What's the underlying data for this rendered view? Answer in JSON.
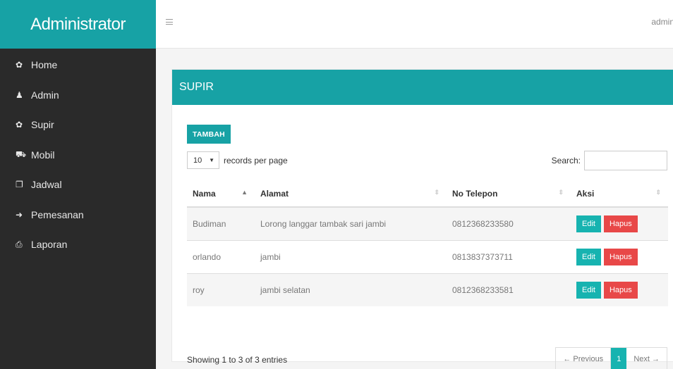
{
  "sidebar": {
    "brand": "Administrator",
    "items": [
      {
        "label": "Home",
        "icon": "dashboard-icon",
        "glyph": "✿"
      },
      {
        "label": "Admin",
        "icon": "user-icon",
        "glyph": "♟"
      },
      {
        "label": "Supir",
        "icon": "driver-icon",
        "glyph": "✿"
      },
      {
        "label": "Mobil",
        "icon": "car-icon",
        "glyph": "⛟"
      },
      {
        "label": "Jadwal",
        "icon": "copy-icon",
        "glyph": "❐"
      },
      {
        "label": "Pemesanan",
        "icon": "sign-in-icon",
        "glyph": "➜"
      },
      {
        "label": "Laporan",
        "icon": "print-icon",
        "glyph": "⎙"
      }
    ]
  },
  "topbar": {
    "user": "admin"
  },
  "panel": {
    "title": "SUPIR",
    "add_button": "TAMBAH",
    "length_value": "10",
    "length_suffix": "records per page",
    "search_label": "Search:",
    "search_value": "",
    "columns": [
      "Nama",
      "Alamat",
      "No Telepon",
      "Aksi"
    ],
    "rows": [
      {
        "nama": "Budiman",
        "alamat": "Lorong langgar tambak sari jambi",
        "telepon": "0812368233580",
        "edit": "Edit",
        "hapus": "Hapus"
      },
      {
        "nama": "orlando",
        "alamat": "jambi",
        "telepon": "0813837373711",
        "edit": "Edit",
        "hapus": "Hapus"
      },
      {
        "nama": "roy",
        "alamat": "jambi selatan",
        "telepon": "0812368233581",
        "edit": "Edit",
        "hapus": "Hapus"
      }
    ],
    "info": "Showing 1 to 3 of 3 entries",
    "pager": {
      "prev": "← Previous",
      "current": "1",
      "next": "Next →"
    }
  },
  "colors": {
    "accent": "#17a2a5",
    "sidebar_bg": "#2a2a2a",
    "edit": "#17b3b0",
    "delete": "#e84848"
  }
}
